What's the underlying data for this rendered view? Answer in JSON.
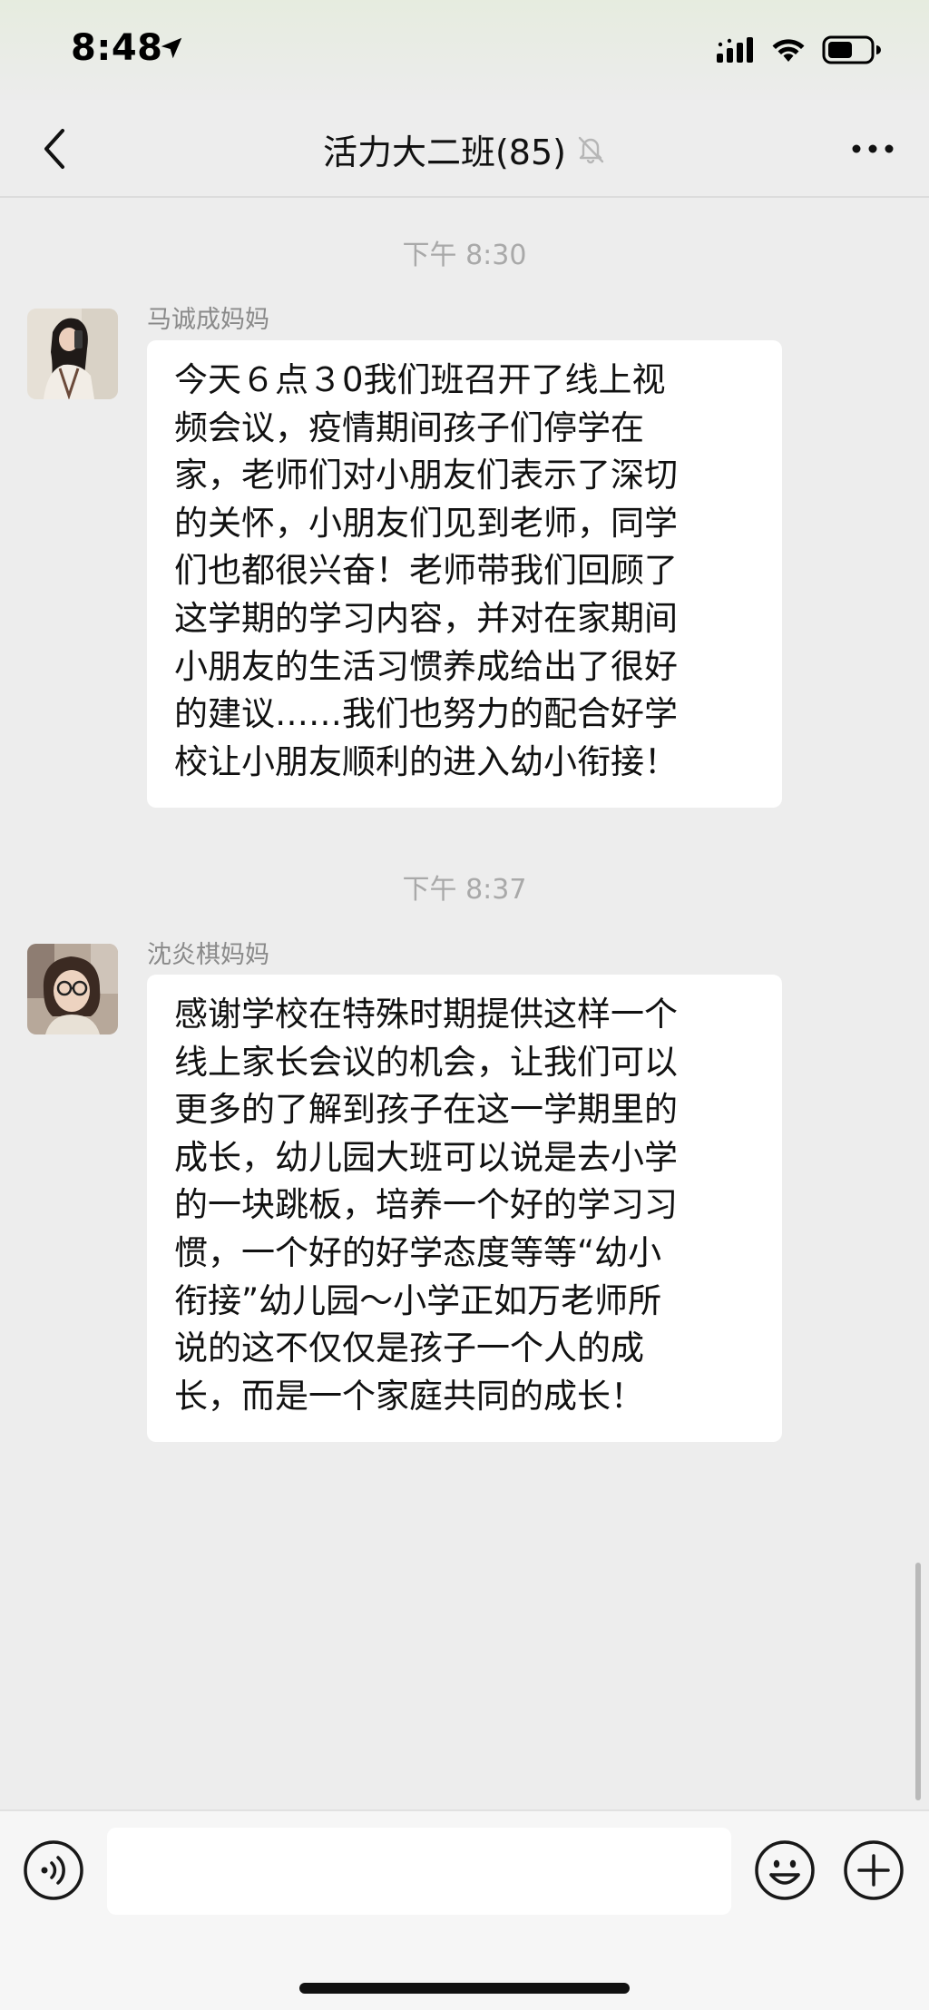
{
  "status_bar": {
    "time": "8:48",
    "icons": [
      "location-arrow-icon",
      "cellular-signal-icon",
      "wifi-icon",
      "battery-icon"
    ]
  },
  "nav": {
    "back_icon": "chevron-left-icon",
    "title": "活力大二班(85)",
    "mute_icon": "muted-bell-icon",
    "more_icon": "more-dots-icon"
  },
  "messages": [
    {
      "timestamp": "下午 8:30",
      "sender": "马诚成妈妈",
      "avatar": "avatar-photo",
      "lines": [
        "今天６点３0我们班召开了线上视",
        "频会议，疫情期间孩子们停学在",
        "家，老师们对小朋友们表示了深切",
        "的关怀，小朋友们见到老师，同学",
        "们也都很兴奋！老师带我们回顾了",
        "这学期的学习内容，并对在家期间",
        "小朋友的生活习惯养成给出了很好",
        "的建议……我们也努力的配合好学",
        "校让小朋友顺利的进入幼小衔接！"
      ]
    },
    {
      "timestamp": "下午 8:37",
      "sender": "沈炎棋妈妈",
      "avatar": "avatar-photo",
      "lines": [
        "感谢学校在特殊时期提供这样一个",
        "线上家长会议的机会，让我们可以",
        "更多的了解到孩子在这一学期里的",
        "成长，幼儿园大班可以说是去小学",
        "的一块跳板，培养一个好的学习习",
        "惯，一个好的好学态度等等“幼小",
        "衔接”幼儿园～小学正如万老师所",
        "说的这不仅仅是孩子一个人的成",
        "长，而是一个家庭共同的成长！"
      ]
    }
  ],
  "input_bar": {
    "voice_icon": "voice-icon",
    "input_value": "",
    "emoji_icon": "emoji-icon",
    "plus_icon": "plus-icon"
  },
  "colors": {
    "background": "#ededed",
    "bubble": "#ffffff",
    "timestamp": "#a9a9a9",
    "sender_name": "#8a8a8a"
  }
}
